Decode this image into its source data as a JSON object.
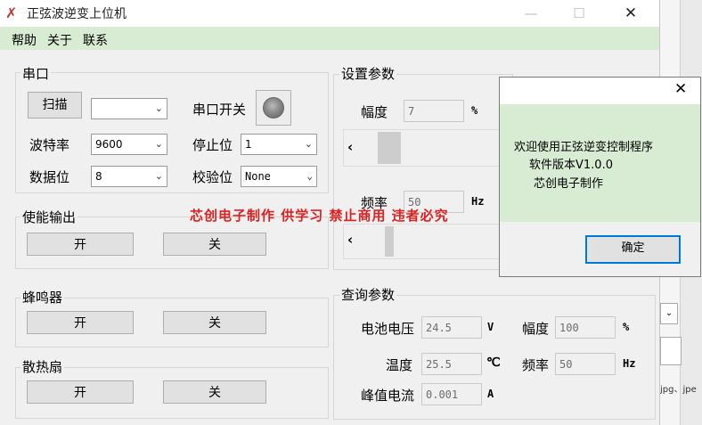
{
  "window": {
    "title": "正弦波逆变上位机",
    "controls": {
      "minimize": "—",
      "maximize": "☐",
      "close": "✕"
    }
  },
  "menu": [
    "帮助",
    "关于",
    "联系"
  ],
  "serial": {
    "title": "串口",
    "scan_label": "扫描",
    "port_value": "",
    "switch_label": "串口开关",
    "baud_label": "波特率",
    "baud_value": "9600",
    "stop_label": "停止位",
    "stop_value": "1",
    "data_label": "数据位",
    "data_value": "8",
    "parity_label": "校验位",
    "parity_value": "None"
  },
  "enable_output": {
    "title": "使能输出",
    "on": "开",
    "off": "关"
  },
  "buzzer": {
    "title": "蜂鸣器",
    "on": "开",
    "off": "关"
  },
  "fan": {
    "title": "散热扇",
    "on": "开",
    "off": "关"
  },
  "settings": {
    "title": "设置参数",
    "amplitude_label": "幅度",
    "amplitude_value": "7",
    "amplitude_unit": "%",
    "frequency_label": "频率",
    "frequency_value": "50",
    "frequency_unit": "Hz",
    "scroll_left": "‹"
  },
  "query": {
    "title": "查询参数",
    "battery_label": "电池电压",
    "battery_value": "24.5",
    "battery_unit": "V",
    "amp_label": "幅度",
    "amp_value": "100",
    "amp_unit": "%",
    "temp_label": "温度",
    "temp_value": "25.5",
    "temp_unit": "℃",
    "freq_label": "频率",
    "freq_value": "50",
    "freq_unit": "Hz",
    "peak_label": "峰值电流",
    "peak_value": "0.001",
    "peak_unit": "A"
  },
  "watermark": "芯创电子制作 供学习 禁止商用 违者必究",
  "dialog": {
    "close": "✕",
    "line1": "欢迎使用正弦逆变控制程序",
    "line2": "软件版本V1.0.0",
    "line3": "芯创电子制作",
    "ok": "确定"
  },
  "background_snippet": "jpg、jpe"
}
